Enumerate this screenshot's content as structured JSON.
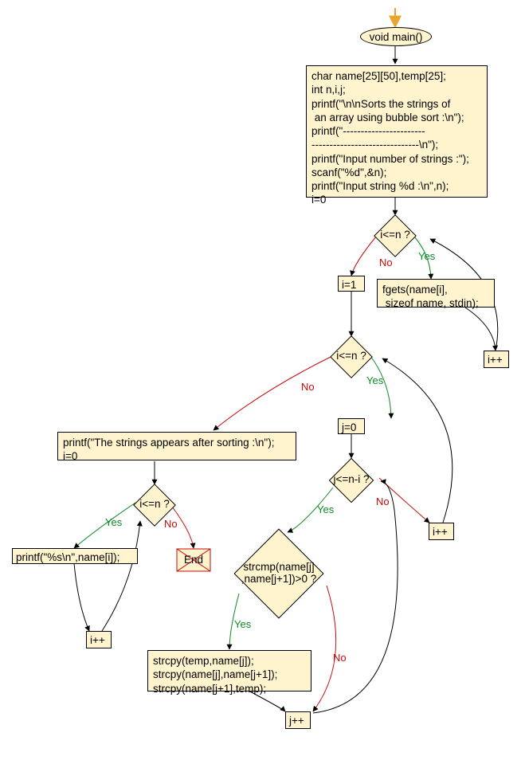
{
  "chart_data": {
    "type": "flowchart",
    "nodes": [
      {
        "id": "start",
        "type": "oval",
        "text": "void main()"
      },
      {
        "id": "init",
        "type": "process",
        "text": "char name[25][50],temp[25];\nint n,i,j;\nprintf(\"\\n\\nSorts the strings of\n an array using bubble sort :\\n\");\nprintf(\"-----------------------\n------------------------------\\n\");\nprintf(\"Input number of strings :\");\nscanf(\"%d\",&n);\nprintf(\"Input string %d :\\n\",n);\ni=0"
      },
      {
        "id": "cond1",
        "type": "decision",
        "text": "i<=n ?"
      },
      {
        "id": "fgets",
        "type": "process",
        "text": "fgets(name[i],\n sizeof name, stdin);"
      },
      {
        "id": "inc1",
        "type": "process",
        "text": "i++"
      },
      {
        "id": "seti1",
        "type": "process",
        "text": "i=1"
      },
      {
        "id": "cond2",
        "type": "decision",
        "text": "i<=n ?"
      },
      {
        "id": "setj0",
        "type": "process",
        "text": "j=0"
      },
      {
        "id": "cond3",
        "type": "decision",
        "text": "j<=n-i ?"
      },
      {
        "id": "inc2",
        "type": "process",
        "text": "i++"
      },
      {
        "id": "cond4",
        "type": "decision",
        "text": "strcmp(name[j]\n,name[j+1])>0 ?"
      },
      {
        "id": "swap",
        "type": "process",
        "text": "strcpy(temp,name[j]);\nstrcpy(name[j],name[j+1]);\nstrcpy(name[j+1],temp);"
      },
      {
        "id": "incj",
        "type": "process",
        "text": "j++"
      },
      {
        "id": "printhdr",
        "type": "process",
        "text": "printf(\"The strings appears after sorting :\\n\");\ni=0"
      },
      {
        "id": "cond5",
        "type": "decision",
        "text": "i<=n ?"
      },
      {
        "id": "printname",
        "type": "process",
        "text": "printf(\"%s\\n\",name[i]);"
      },
      {
        "id": "inc3",
        "type": "process",
        "text": "i++"
      },
      {
        "id": "end",
        "type": "terminal",
        "text": "End"
      }
    ],
    "edges": [
      {
        "from": "start",
        "to": "init"
      },
      {
        "from": "init",
        "to": "cond1"
      },
      {
        "from": "cond1",
        "to": "fgets",
        "label": "Yes"
      },
      {
        "from": "fgets",
        "to": "inc1"
      },
      {
        "from": "inc1",
        "to": "cond1"
      },
      {
        "from": "cond1",
        "to": "seti1",
        "label": "No"
      },
      {
        "from": "seti1",
        "to": "cond2"
      },
      {
        "from": "cond2",
        "to": "setj0",
        "label": "Yes"
      },
      {
        "from": "setj0",
        "to": "cond3"
      },
      {
        "from": "cond3",
        "to": "cond4",
        "label": "Yes"
      },
      {
        "from": "cond3",
        "to": "inc2",
        "label": "No"
      },
      {
        "from": "inc2",
        "to": "cond2"
      },
      {
        "from": "cond4",
        "to": "swap",
        "label": "Yes"
      },
      {
        "from": "cond4",
        "to": "incj",
        "label": "No"
      },
      {
        "from": "swap",
        "to": "incj"
      },
      {
        "from": "incj",
        "to": "cond3"
      },
      {
        "from": "cond2",
        "to": "printhdr",
        "label": "No"
      },
      {
        "from": "printhdr",
        "to": "cond5"
      },
      {
        "from": "cond5",
        "to": "printname",
        "label": "Yes"
      },
      {
        "from": "printname",
        "to": "inc3"
      },
      {
        "from": "inc3",
        "to": "cond5"
      },
      {
        "from": "cond5",
        "to": "end",
        "label": "No"
      }
    ]
  },
  "labels": {
    "start": "void main()",
    "init": "char name[25][50],temp[25];\nint n,i,j;\nprintf(\"\\n\\nSorts the strings of\n an array using bubble sort :\\n\");\nprintf(\"-----------------------\n------------------------------\\n\");\nprintf(\"Input number of strings :\");\nscanf(\"%d\",&n);\nprintf(\"Input string %d :\\n\",n);\ni=0",
    "cond1": "i<=n ?",
    "fgets": "fgets(name[i],\n sizeof name, stdin);",
    "inc1": "i++",
    "seti1": "i=1",
    "cond2": "i<=n ?",
    "setj0": "j=0",
    "cond3": "j<=n-i ?",
    "inc2": "i++",
    "cond4": "strcmp(name[j]\n,name[j+1])>0 ?",
    "swap": "strcpy(temp,name[j]);\nstrcpy(name[j],name[j+1]);\nstrcpy(name[j+1],temp);",
    "incj": "j++",
    "printhdr": "printf(\"The strings appears after sorting :\\n\");\ni=0",
    "cond5": "i<=n ?",
    "printname": "printf(\"%s\\n\",name[i]);",
    "inc3": "i++",
    "end": "End",
    "yes": "Yes",
    "no": "No"
  }
}
